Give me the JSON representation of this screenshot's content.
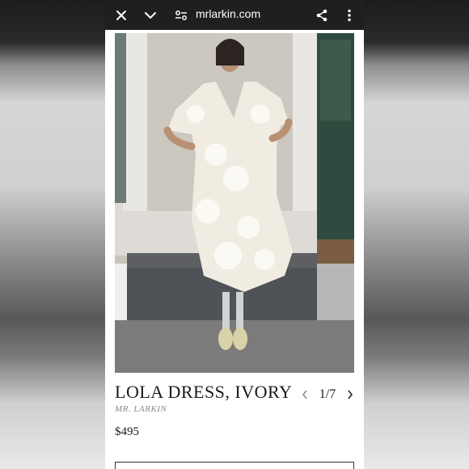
{
  "browser": {
    "url": "mrlarkin.com"
  },
  "icons": {
    "close": "close-icon",
    "collapse": "chevron-down-icon",
    "site_settings": "tune-icon",
    "share": "share-icon",
    "menu": "more-vert-icon"
  },
  "product": {
    "title": "LOLA DRESS, IVORY",
    "brand": "MR. LARKIN",
    "price": "$495",
    "pager": {
      "current": "1/7"
    }
  },
  "colors": {
    "toolbar": "#1f1f1f",
    "page": "#ffffff",
    "text": "#1a1a1a",
    "brand_text": "#8a8a8a"
  }
}
